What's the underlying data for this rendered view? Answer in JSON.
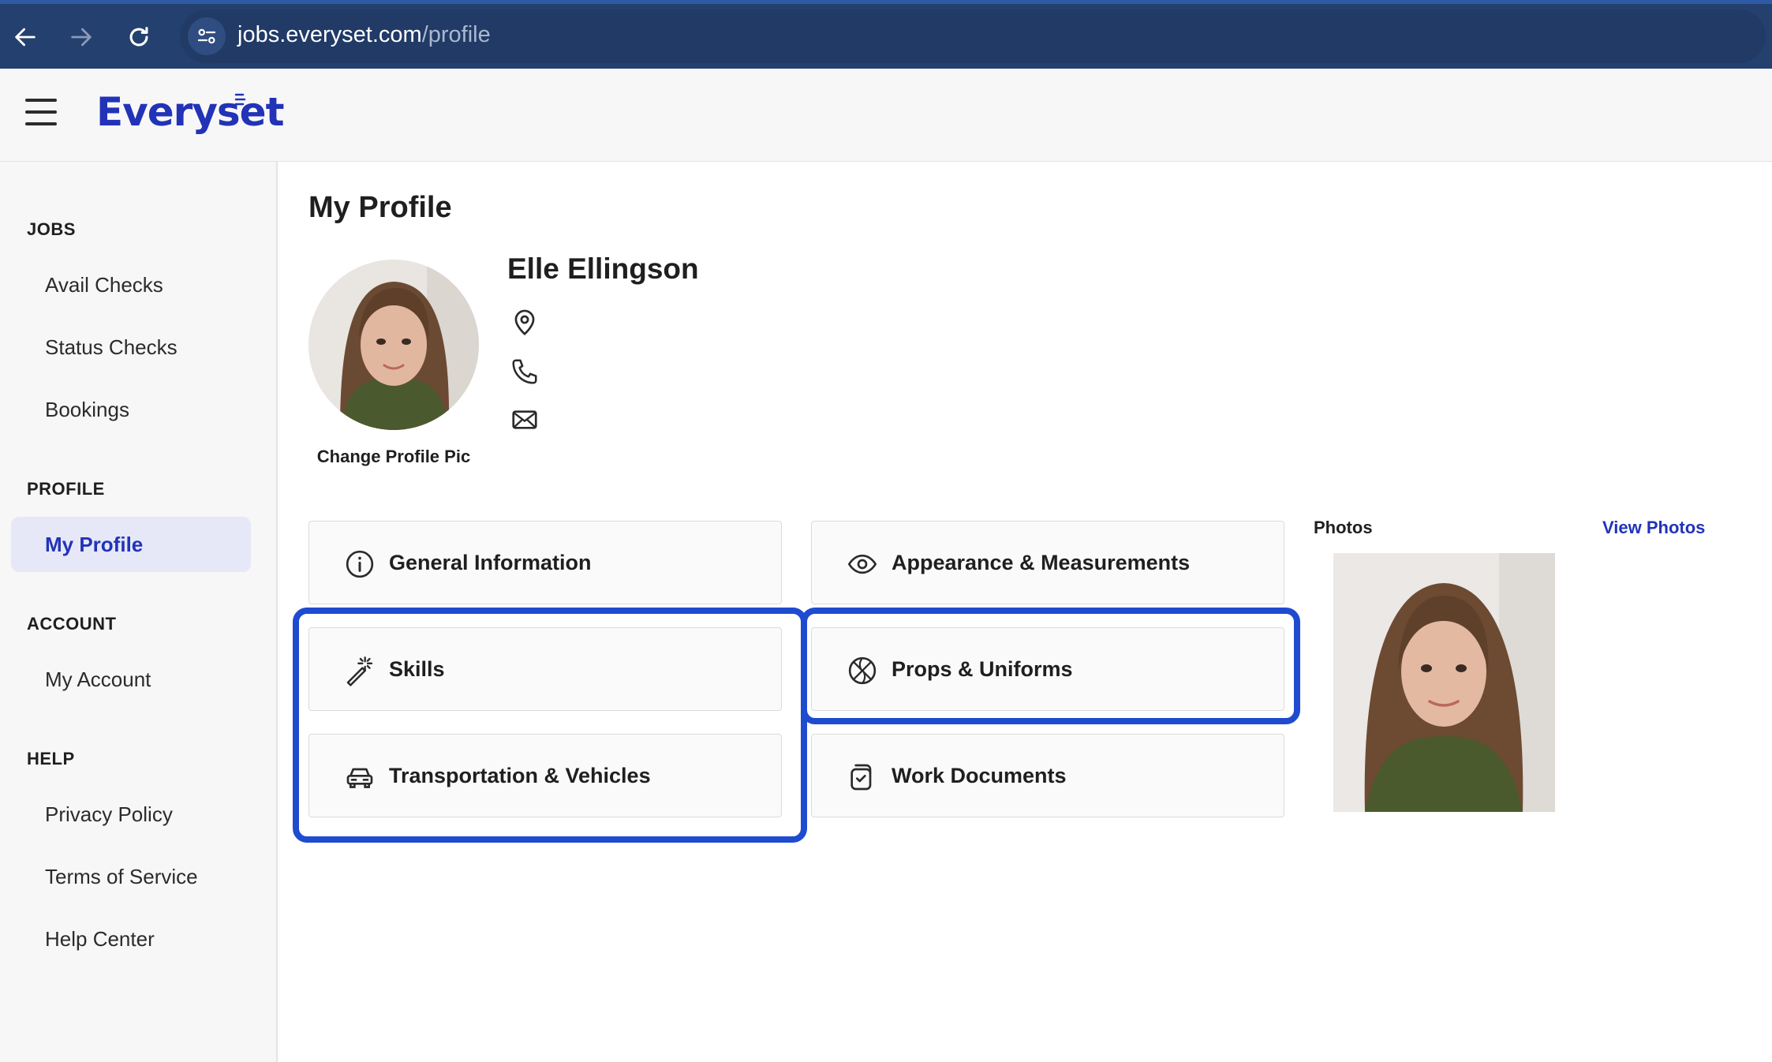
{
  "browser": {
    "url_domain": "jobs.everyset.com",
    "url_path": "/profile"
  },
  "header": {
    "logo": "Everyset"
  },
  "sidebar": {
    "sections": [
      {
        "title": "JOBS",
        "items": [
          "Avail Checks",
          "Status Checks",
          "Bookings"
        ]
      },
      {
        "title": "PROFILE",
        "items": [
          "My Profile"
        ]
      },
      {
        "title": "ACCOUNT",
        "items": [
          "My Account"
        ]
      },
      {
        "title": "HELP",
        "items": [
          "Privacy Policy",
          "Terms of Service",
          "Help Center"
        ]
      }
    ],
    "active_item": "My Profile"
  },
  "main": {
    "title": "My Profile",
    "change_pic": "Change Profile Pic",
    "name": "Elle Ellingson",
    "contact_icons": [
      "location-pin-icon",
      "phone-icon",
      "email-icon"
    ],
    "cards": [
      {
        "label": "General Information",
        "icon": "info-icon"
      },
      {
        "label": "Appearance & Measurements",
        "icon": "eye-icon"
      },
      {
        "label": "Skills",
        "icon": "magic-wand-icon"
      },
      {
        "label": "Props & Uniforms",
        "icon": "basketball-icon"
      },
      {
        "label": "Transportation & Vehicles",
        "icon": "car-icon"
      },
      {
        "label": "Work Documents",
        "icon": "documents-icon"
      }
    ],
    "photos_label": "Photos",
    "view_photos": "View Photos"
  },
  "colors": {
    "browser_bar": "#24406f",
    "brand": "#2233b8",
    "highlight": "#1f4bd0",
    "active_bg": "#e6e8f8"
  }
}
